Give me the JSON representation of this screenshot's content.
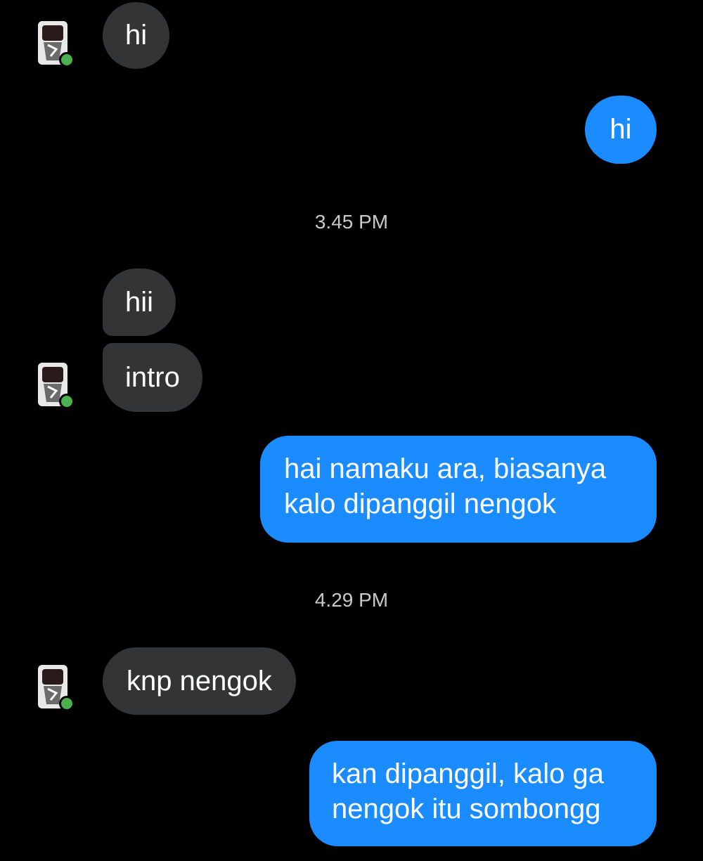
{
  "messages": [
    {
      "side": "incoming",
      "text": "hi"
    },
    {
      "side": "outgoing",
      "text": "hi"
    },
    {
      "type": "timestamp",
      "text": "3.45 PM"
    },
    {
      "side": "incoming",
      "text": "hii"
    },
    {
      "side": "incoming",
      "text": "intro"
    },
    {
      "side": "outgoing",
      "text": "hai namaku ara, biasanya kalo dipanggil nengok",
      "lines": [
        "hai namaku ara, biasanya",
        "kalo dipanggil nengok"
      ]
    },
    {
      "type": "timestamp",
      "text": "4.29 PM"
    },
    {
      "side": "incoming",
      "text": "knp nengok"
    },
    {
      "side": "outgoing",
      "text": "kan dipanggil, kalo ga nengok itu sombongg",
      "lines": [
        "kan dipanggil, kalo ga",
        "nengok itu sombongg"
      ]
    }
  ],
  "avatar": {
    "icon": "profile-avatar-icon",
    "online": true
  },
  "colors": {
    "background": "#000000",
    "incoming_bubble": "#333436",
    "outgoing_bubble": "#1a8cff",
    "online_dot": "#4caf50",
    "timestamp": "#c9c9c9"
  }
}
